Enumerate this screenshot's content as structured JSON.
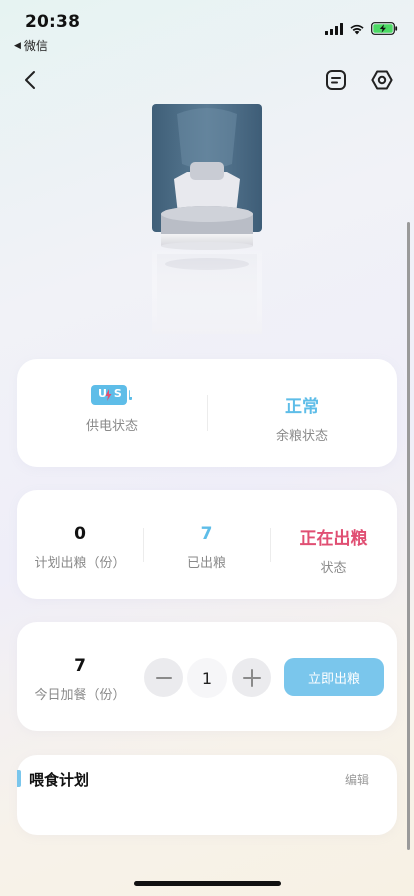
{
  "status_bar": {
    "time": "20:38",
    "back_app": "微信"
  },
  "device_status": {
    "power": {
      "badge": "USB",
      "label": "供电状态"
    },
    "food": {
      "value": "正常",
      "label": "余粮状态"
    }
  },
  "stats": {
    "planned": {
      "value": "0",
      "label": "计划出粮（份）"
    },
    "dispensed": {
      "value": "7",
      "label": "已出粮"
    },
    "state": {
      "value": "正在出粮",
      "label": "状态"
    }
  },
  "extra_meal": {
    "today_value": "7",
    "today_label": "今日加餐（份）",
    "quantity": "1",
    "feed_button": "立即出粮"
  },
  "plan": {
    "title": "喂食计划",
    "edit": "编辑"
  },
  "colors": {
    "accent": "#7ac6ec",
    "value_blue": "#5ebde8",
    "alert_red": "#e04f73"
  }
}
